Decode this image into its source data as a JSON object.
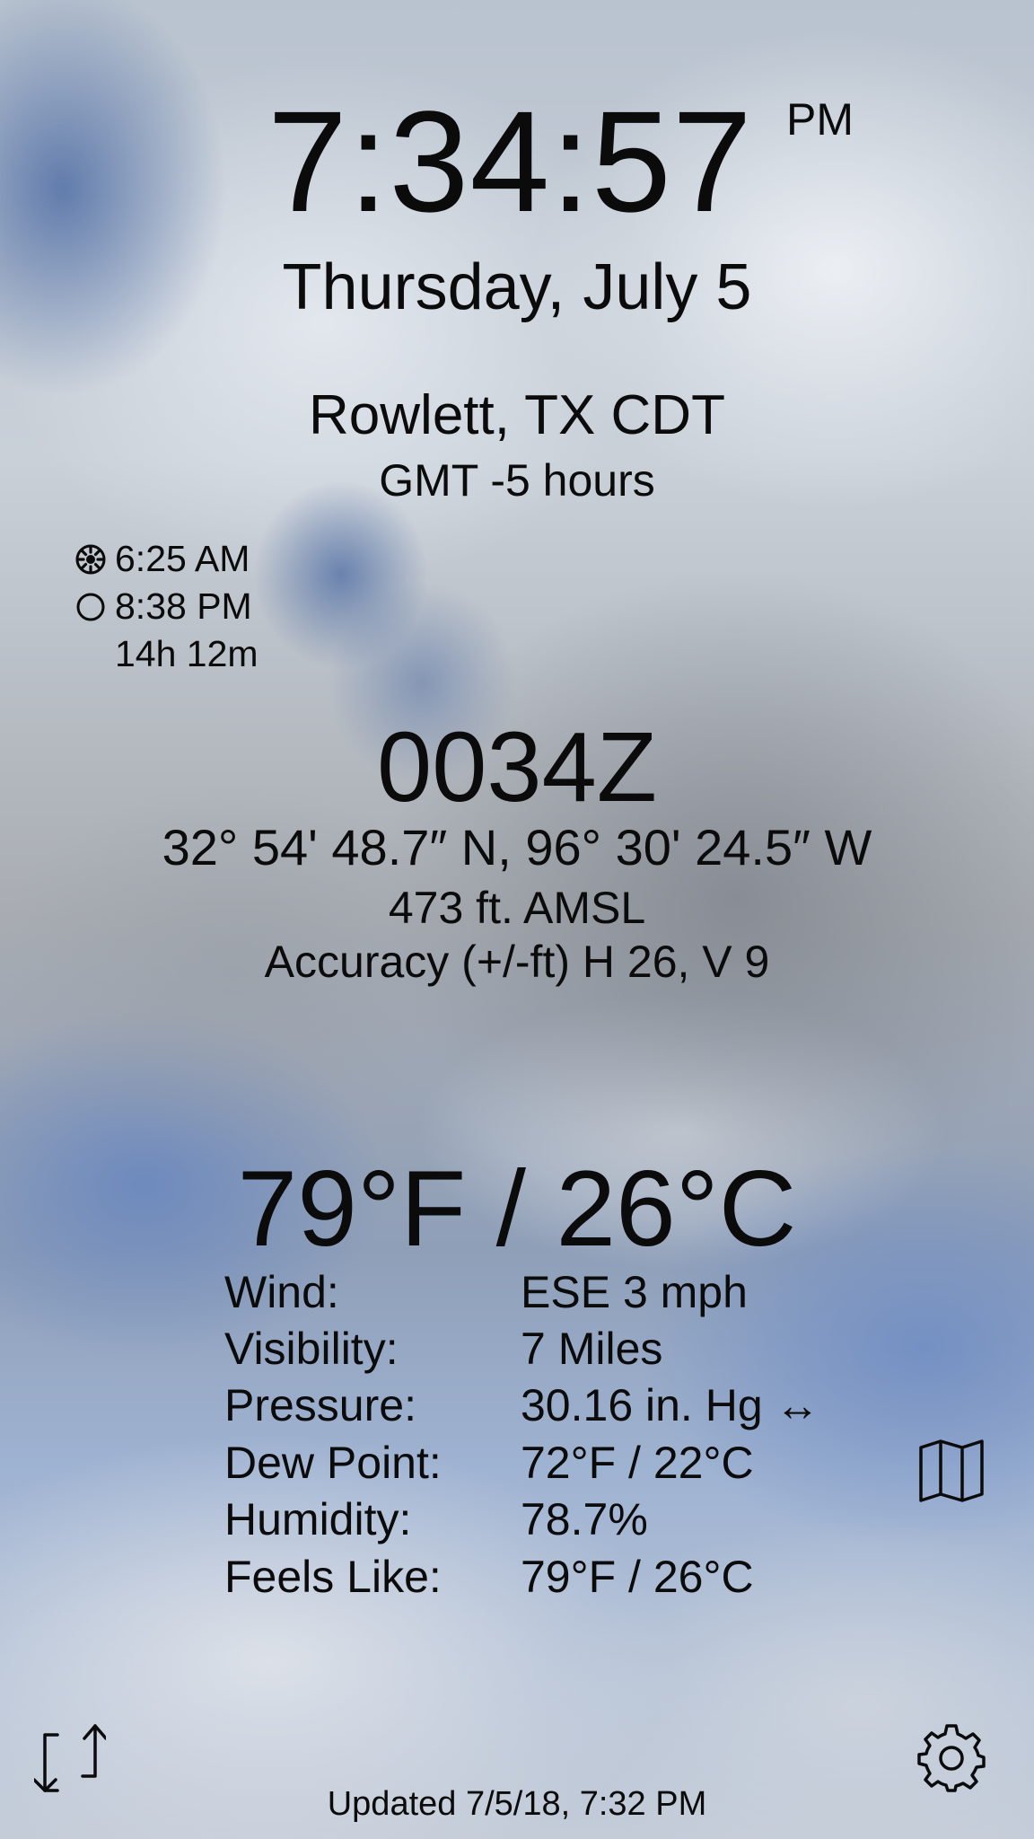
{
  "clock": {
    "time": "7:34:57",
    "ampm": "PM",
    "date": "Thursday, July 5"
  },
  "location": {
    "name": "Rowlett, TX CDT",
    "gmt_offset": "GMT -5 hours"
  },
  "sun": {
    "sunrise": "6:25 AM",
    "sunset": "8:38 PM",
    "day_length": "14h 12m",
    "sunrise_icon": "sun-icon",
    "sunset_icon": "moon-circle-icon"
  },
  "gps": {
    "zulu_time": "0034Z",
    "coordinates": "32° 54' 48.7″ N, 96° 30' 24.5″ W",
    "altitude": "473 ft. AMSL",
    "accuracy": "Accuracy (+/-ft) H 26, V 9"
  },
  "weather": {
    "temperature": "79°F / 26°C",
    "rows": [
      {
        "label": "Wind:",
        "value": "ESE 3 mph"
      },
      {
        "label": "Visibility:",
        "value": "7 Miles"
      },
      {
        "label": "Pressure:",
        "value": "30.16 in. Hg ↔"
      },
      {
        "label": "Dew Point:",
        "value": "72°F / 22°C"
      },
      {
        "label": "Humidity:",
        "value": "78.7%"
      },
      {
        "label": "Feels Like:",
        "value": "79°F / 26°C"
      }
    ]
  },
  "footer": {
    "updated": "Updated 7/5/18, 7:32 PM"
  },
  "icons": {
    "map": "map-icon",
    "swap": "swap-arrows-icon",
    "settings": "gear-icon"
  }
}
